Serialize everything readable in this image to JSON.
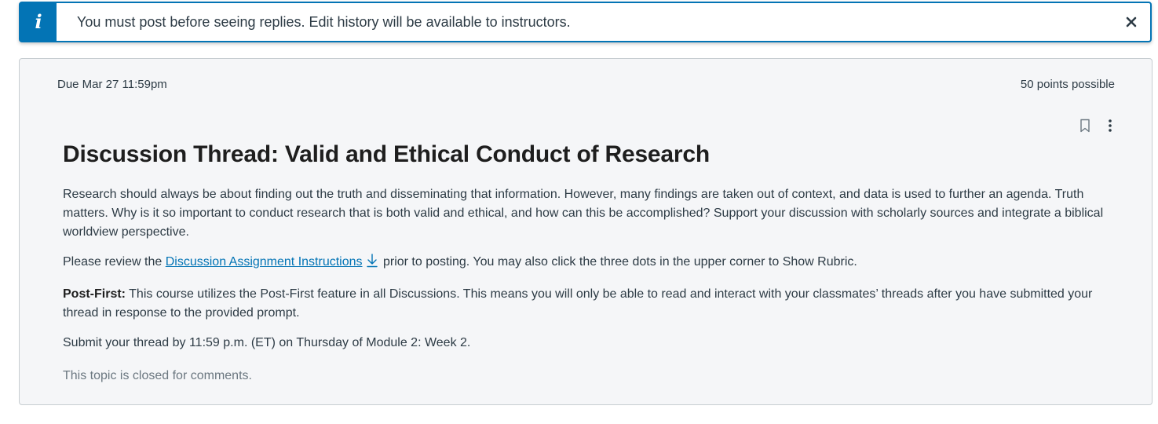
{
  "alert": {
    "icon": "info-icon",
    "message": "You must post before seeing replies. Edit history will be available to instructors.",
    "close_icon": "close-icon",
    "accent_color": "#0374b5"
  },
  "discussion": {
    "due": "Due Mar 27 11:59pm",
    "points": "50 points possible",
    "actions": {
      "bookmark_icon": "bookmark-icon",
      "more_icon": "more-vertical-icon"
    },
    "title": "Discussion Thread: Valid and Ethical Conduct of Research",
    "paragraph1": "Research should always be about finding out the truth and disseminating that information. However, many findings are taken out of context, and data is used to further an agenda. Truth matters. Why is it so important to conduct research that is both valid and ethical, and how can this be accomplished? Support your discussion with scholarly sources and integrate a biblical worldview perspective.",
    "paragraph2": {
      "before": "Please review the ",
      "link": "Discussion Assignment Instructions",
      "link_icon": "download-icon",
      "after": " prior to posting. You may also click the three dots in the upper corner to Show Rubric."
    },
    "paragraph3": {
      "bold": "Post-First:",
      "text": " This course utilizes the Post-First feature in all Discussions. This means you will only be able to read and interact with your classmates’ threads after you have submitted your thread in response to the provided prompt."
    },
    "paragraph4": "Submit your thread by 11:59 p.m. (ET) on Thursday of Module 2: Week 2.",
    "closed_notice": "This topic is closed for comments.",
    "link_color": "#0374b5"
  }
}
